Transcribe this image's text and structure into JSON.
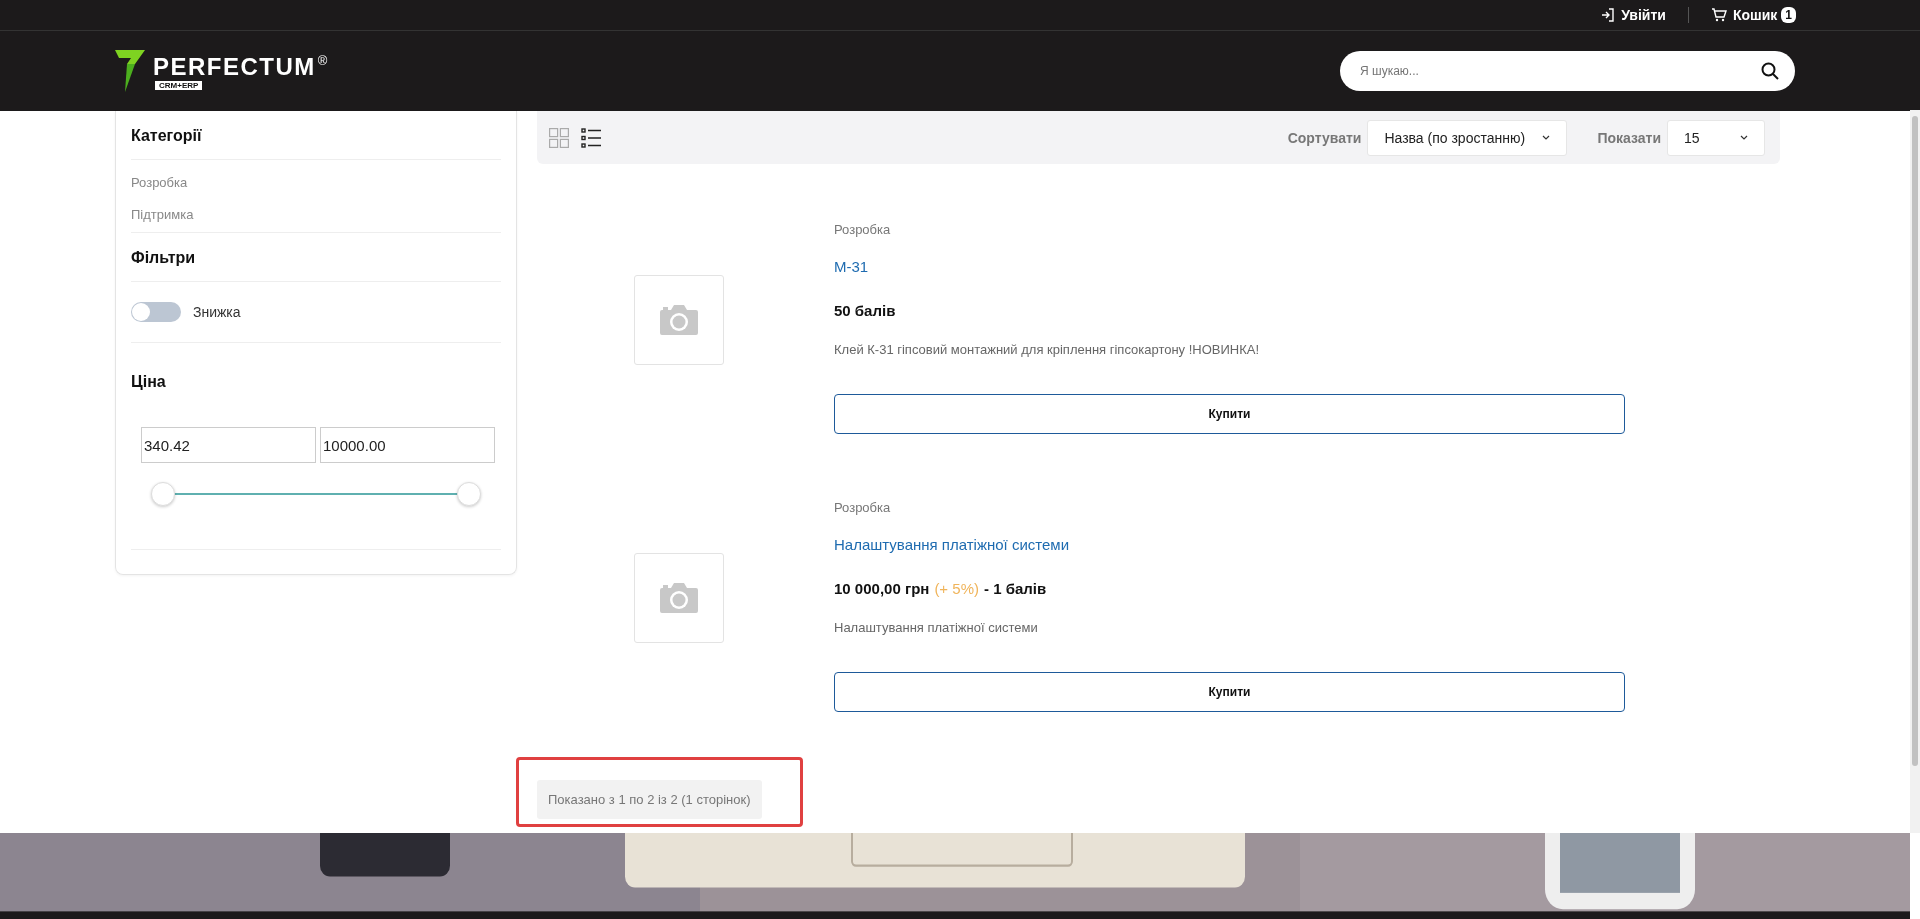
{
  "top_bar": {
    "login": "Увійти",
    "cart": "Кошик",
    "cart_count": "1"
  },
  "header": {
    "logo": {
      "name": "PERFECTUM",
      "mark": "®",
      "tagline": "CRM+ERP"
    },
    "search": {
      "placeholder": "Я шукаю..."
    }
  },
  "sidebar": {
    "categories_title": "Категорії",
    "categories": [
      "Розробка",
      "Підтримка"
    ],
    "filters_title": "Фільтри",
    "discount_toggle": {
      "label": "Знижка",
      "on": false
    },
    "price_title": "Ціна",
    "price_min": "340.42",
    "price_max": "10000.00",
    "price_thumbs": [
      {
        "level": 0
      },
      {
        "level": 1
      }
    ]
  },
  "toolbar": {
    "views": [
      {
        "kind": "grid",
        "selected": false
      },
      {
        "kind": "list",
        "selected": true
      }
    ],
    "sort_label": "Сортувати",
    "sort_value": "Назва (по зростанню)",
    "show_label": "Показати",
    "show_value": "15"
  },
  "products": [
    {
      "category": "Розробка",
      "name": "М-31",
      "price": "50 балів",
      "description": "Клей К-31 гіпсовий монтажний для кріплення гіпсокартону !НОВИНКА!",
      "button": "Купити"
    },
    {
      "category": "Розробка",
      "name": "Налаштування платіжної системи",
      "price": "10 000,00 грн",
      "price_extra": "(+ 5%)",
      "price_tail": "- 1 балів",
      "description": "Налаштування платіжної системи",
      "button": "Купити"
    }
  ],
  "pagination_info": {
    "text": "Показано з 1 по 2 із 2 (1 сторінок)",
    "highlighted": true
  }
}
